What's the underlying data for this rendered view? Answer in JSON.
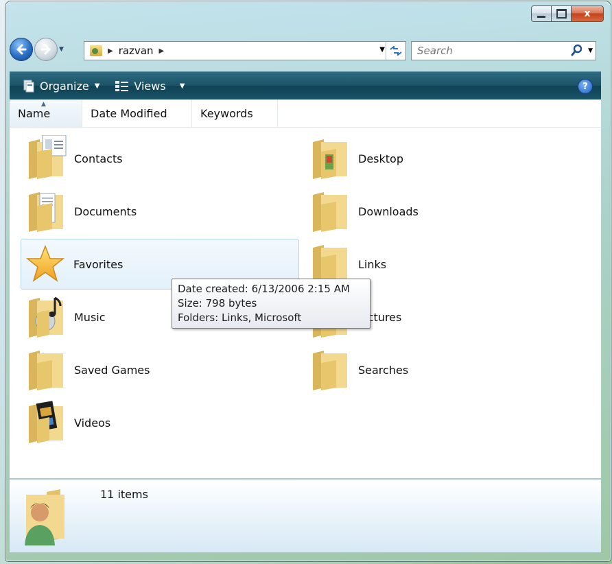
{
  "window": {
    "close_glyph": "x",
    "address_path": [
      "razvan"
    ],
    "search_placeholder": "Search"
  },
  "toolbar": {
    "organize_label": "Organize",
    "views_label": "Views",
    "help_glyph": "?"
  },
  "columns": [
    "Name",
    "Date Modified",
    "Keywords"
  ],
  "items": [
    {
      "label": "Contacts",
      "icon": "contacts-folder-icon"
    },
    {
      "label": "Desktop",
      "icon": "desktop-folder-icon"
    },
    {
      "label": "Documents",
      "icon": "documents-folder-icon"
    },
    {
      "label": "Downloads",
      "icon": "downloads-folder-icon"
    },
    {
      "label": "Favorites",
      "icon": "favorites-star-icon",
      "selected": true
    },
    {
      "label": "Links",
      "icon": "links-folder-icon"
    },
    {
      "label": "Music",
      "icon": "music-folder-icon"
    },
    {
      "label": "Pictures",
      "icon": "pictures-folder-icon"
    },
    {
      "label": "Saved Games",
      "icon": "saved-games-folder-icon"
    },
    {
      "label": "Searches",
      "icon": "searches-folder-icon"
    },
    {
      "label": "Videos",
      "icon": "videos-folder-icon"
    }
  ],
  "tooltip": {
    "line1": "Date created: 6/13/2006 2:15 AM",
    "line2": "Size: 798 bytes",
    "line3": "Folders: Links, Microsoft"
  },
  "status": {
    "count": "11 items"
  }
}
